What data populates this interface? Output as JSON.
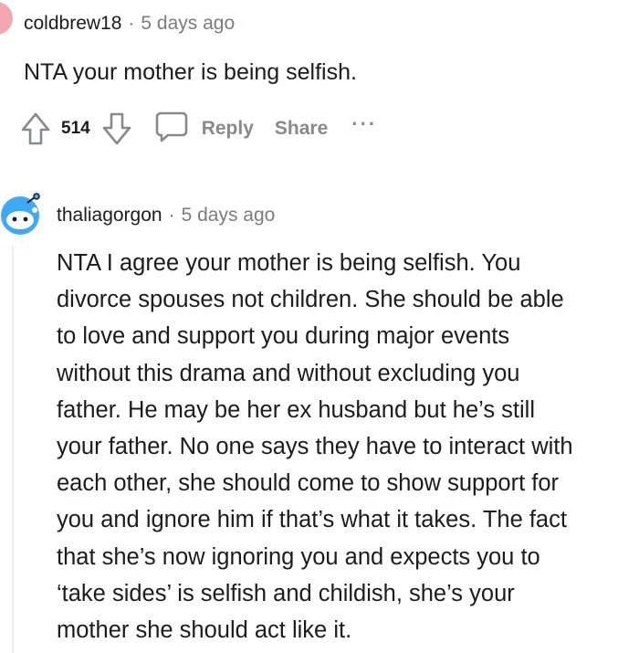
{
  "comments": [
    {
      "username": "coldbrew18",
      "separator": "·",
      "time": "5 days ago",
      "text": "NTA your mother is being selfish.",
      "score": "514",
      "reply_label": "Reply",
      "share_label": "Share",
      "more_label": "···",
      "avatar_color": "#f4a7b3"
    },
    {
      "username": "thaliagorgon",
      "separator": "·",
      "time": "5 days ago",
      "avatar_color": "#3fa9f5",
      "text_lines": [
        "NTA I agree your mother is being selfish. You",
        "divorce spouses not children. She should be able",
        "to love and support you during major events",
        "without this drama and without excluding you",
        "father. He may be her ex husband but he’s still",
        "your father. No one says they have to interact with",
        "each other, she should come to show support for",
        "you and ignore him if that’s what it takes. The fact",
        "that she’s now ignoring you and expects you to",
        "‘take sides’ is selfish and childish, she’s your",
        "mother she should act like it."
      ]
    }
  ],
  "icons": {
    "upvote": "upvote-arrow-icon",
    "downvote": "downvote-arrow-icon",
    "reply": "speech-bubble-icon",
    "avatar2": "snoo-avatar-icon"
  }
}
